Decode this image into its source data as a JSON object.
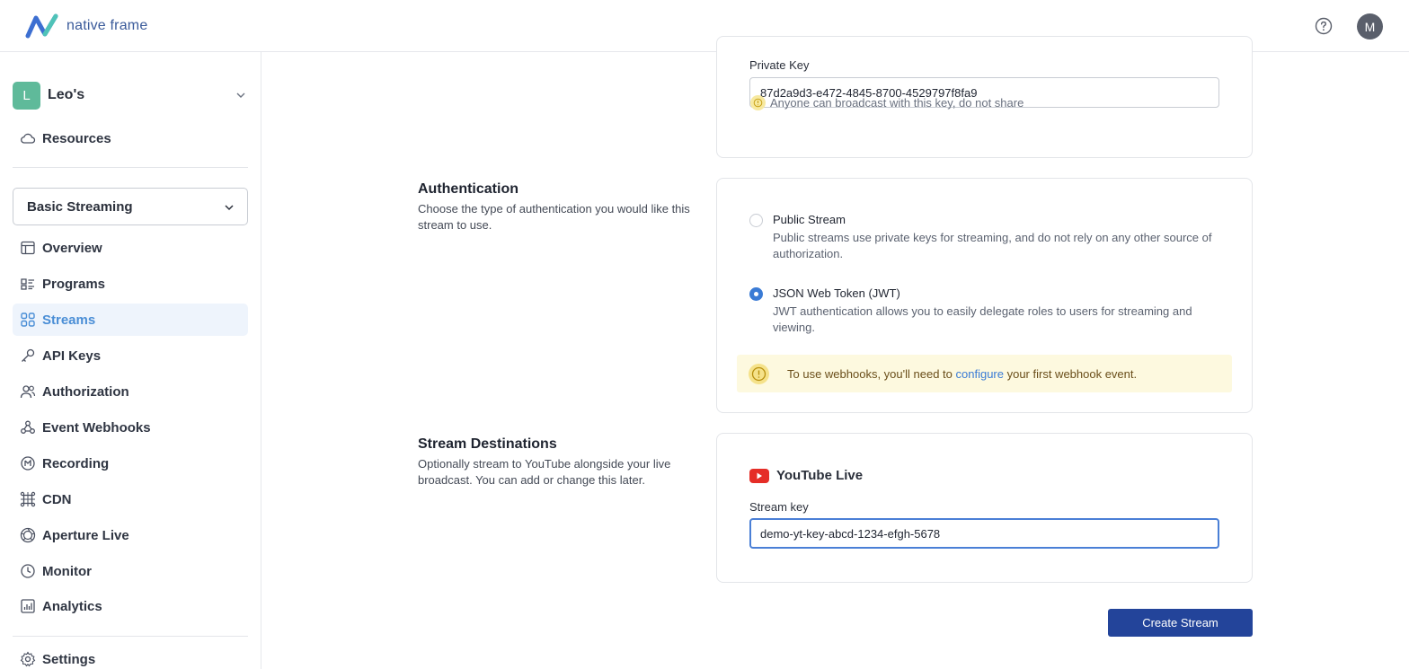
{
  "header": {
    "brand": "native frame",
    "avatar_initial": "M",
    "help_icon": "help-circle-icon"
  },
  "sidebar": {
    "org": {
      "initial": "L",
      "name": "Leo's"
    },
    "resources_label": "Resources",
    "project": "Basic Streaming",
    "items": [
      {
        "label": "Overview",
        "icon": "layout-icon"
      },
      {
        "label": "Programs",
        "icon": "programs-icon"
      },
      {
        "label": "Streams",
        "icon": "grid-icon",
        "active": true
      },
      {
        "label": "API Keys",
        "icon": "key-icon"
      },
      {
        "label": "Authorization",
        "icon": "users-icon"
      },
      {
        "label": "Event Webhooks",
        "icon": "webhook-icon"
      },
      {
        "label": "Recording",
        "icon": "record-icon"
      },
      {
        "label": "CDN",
        "icon": "cdn-icon"
      },
      {
        "label": "Aperture Live",
        "icon": "aperture-icon"
      },
      {
        "label": "Monitor",
        "icon": "clock-icon"
      },
      {
        "label": "Analytics",
        "icon": "chart-icon"
      }
    ],
    "settings_label": "Settings"
  },
  "private_key": {
    "label": "Private Key",
    "value": "87d2a9d3-e472-4845-8700-4529797f8fa9",
    "warning": "Anyone can broadcast with this key, do not share"
  },
  "authentication": {
    "title": "Authentication",
    "description": "Choose the type of authentication you would like this stream to use.",
    "options": [
      {
        "title": "Public Stream",
        "description": "Public streams use private keys for streaming, and do not rely on any other source of authorization.",
        "checked": false
      },
      {
        "title": "JSON Web Token (JWT)",
        "description": "JWT authentication allows you to easily delegate roles to users for streaming and viewing.",
        "checked": true
      }
    ],
    "notice": {
      "before": "To use webhooks, you'll need to ",
      "link": "configure",
      "after": " your first webhook event."
    }
  },
  "destinations": {
    "title": "Stream Destinations",
    "description": "Optionally stream to YouTube alongside your live broadcast. You can add or change this later.",
    "youtube_title": "YouTube Live",
    "stream_key_label": "Stream key",
    "stream_key_value": "demo-yt-key-abcd-1234-efgh-5678"
  },
  "create_button": "Create Stream",
  "colors": {
    "primary": "#23449a",
    "accent": "#4a8ed6",
    "active_bg": "#eef4fc",
    "org_badge": "#5fba9a",
    "notice_bg": "#fdf9df"
  }
}
